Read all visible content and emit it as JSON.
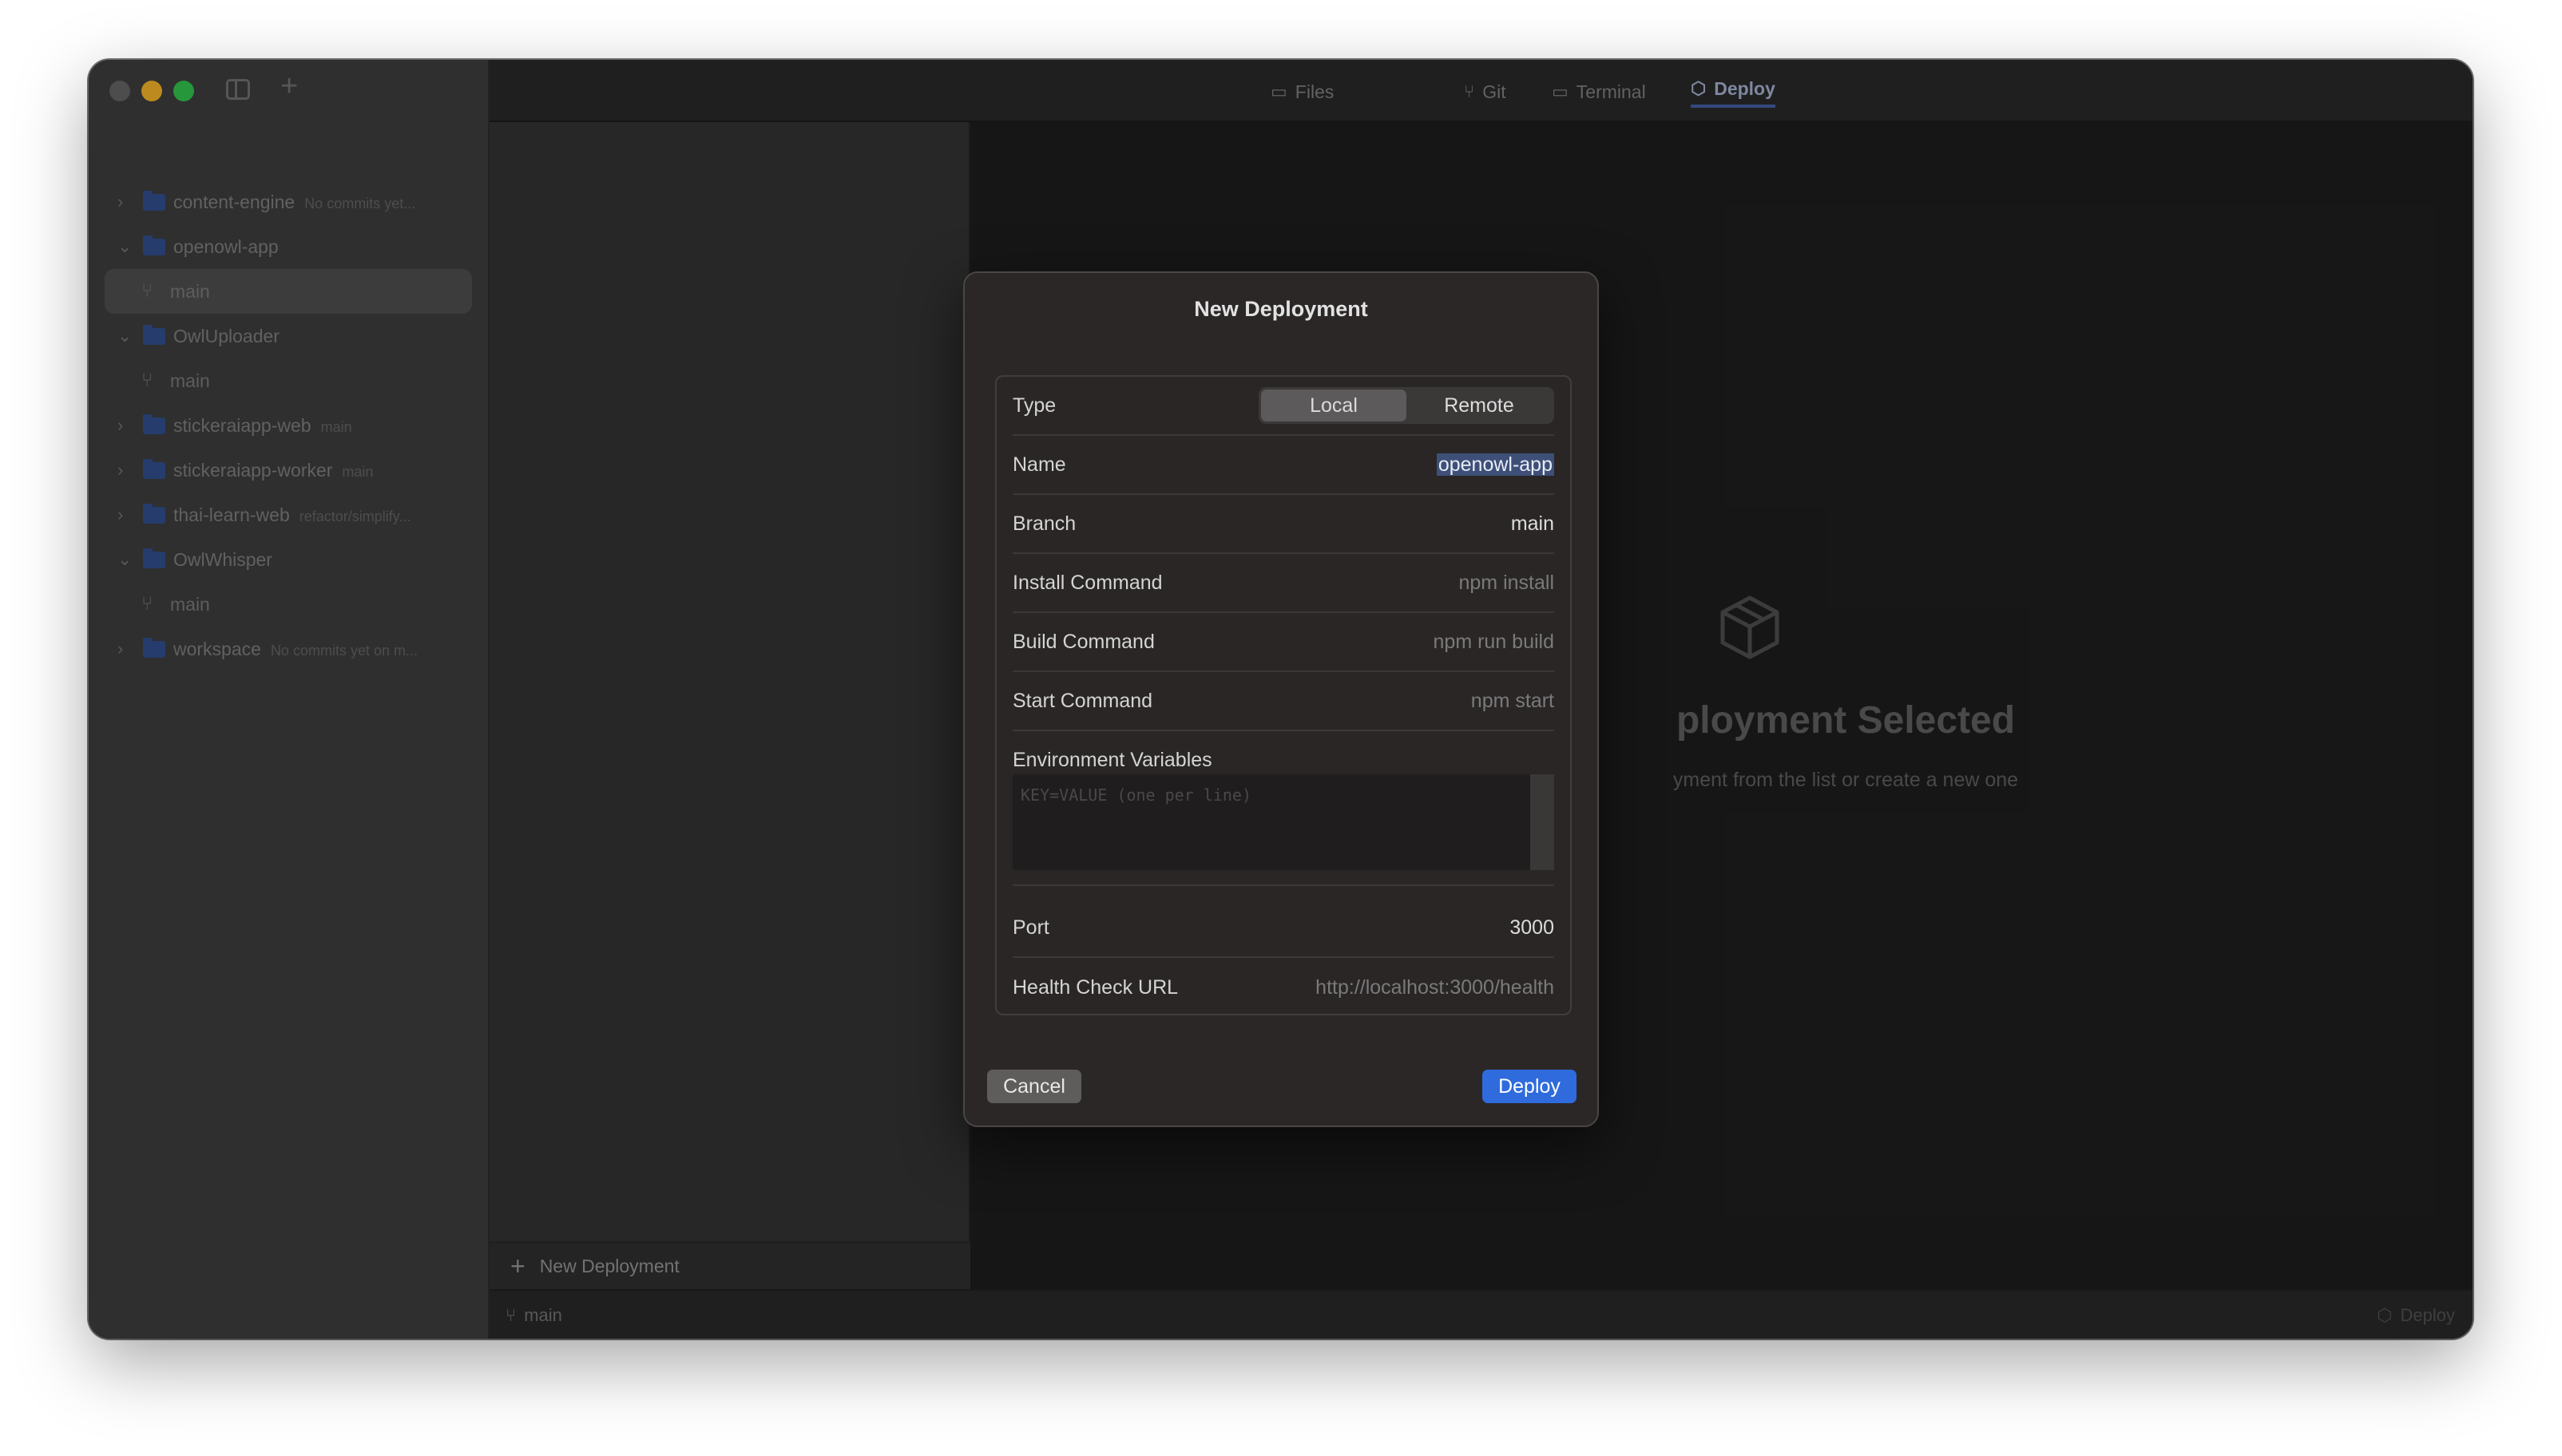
{
  "sidebar": {
    "repos": [
      {
        "name": "content-engine",
        "meta": "No commits yet..."
      },
      {
        "name": "openowl-app",
        "meta": ""
      },
      {
        "branch": "main"
      },
      {
        "name": "OwlUploader",
        "meta": ""
      },
      {
        "branch": "main"
      },
      {
        "name": "stickeraiapp-web",
        "meta": "main"
      },
      {
        "name": "stickeraiapp-worker",
        "meta": "main"
      },
      {
        "name": "thai-learn-web",
        "meta": "refactor/simplify..."
      },
      {
        "name": "OwlWhisper",
        "meta": ""
      },
      {
        "branch": "main"
      },
      {
        "name": "workspace",
        "meta": "No commits yet on m..."
      }
    ]
  },
  "tabs": {
    "files": "Files",
    "git": "Git",
    "terminal": "Terminal",
    "deploy": "Deploy"
  },
  "list_pane": {
    "new_deployment": "New Deployment"
  },
  "status": {
    "branch": "main",
    "deploy": "Deploy"
  },
  "empty_state": {
    "title": "ployment Selected",
    "subtitle": "yment from the list or create a new one"
  },
  "modal": {
    "title": "New Deployment",
    "type_label": "Type",
    "type_options": [
      "Local",
      "Remote"
    ],
    "type_selected": "Local",
    "name_label": "Name",
    "name_value": "openowl-app",
    "branch_label": "Branch",
    "branch_value": "main",
    "install_label": "Install Command",
    "install_placeholder": "npm install",
    "build_label": "Build Command",
    "build_placeholder": "npm run build",
    "start_label": "Start Command",
    "start_placeholder": "npm start",
    "env_label": "Environment Variables",
    "env_placeholder": "KEY=VALUE (one per line)",
    "port_label": "Port",
    "port_value": "3000",
    "health_label": "Health Check URL",
    "health_placeholder": "http://localhost:3000/health",
    "cancel": "Cancel",
    "deploy": "Deploy"
  },
  "colors": {
    "accent": "#2f6bdc",
    "folder": "#2e4a86"
  }
}
